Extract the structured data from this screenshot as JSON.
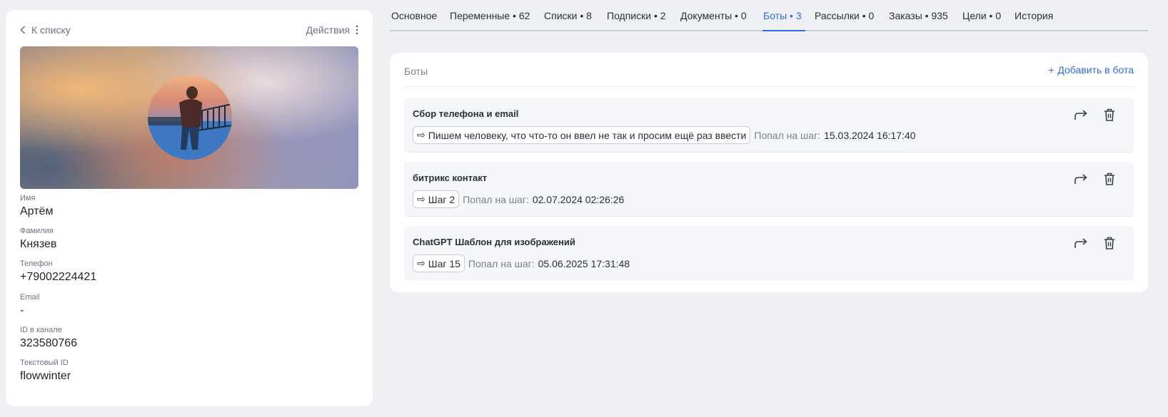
{
  "profile": {
    "back_label": "К списку",
    "actions_label": "Действия",
    "fields": [
      {
        "label": "Имя",
        "value": "Артём"
      },
      {
        "label": "Фамилия",
        "value": "Князев"
      },
      {
        "label": "Телефон",
        "value": "+79002224421"
      },
      {
        "label": "Email",
        "value": "-"
      },
      {
        "label": "ID в канале",
        "value": "323580766"
      },
      {
        "label": "Текстовый ID",
        "value": "flowwinter"
      }
    ]
  },
  "tabs": [
    {
      "label": "Основное",
      "active": false
    },
    {
      "label": "Переменные • 62",
      "active": false
    },
    {
      "label": "Списки • 8",
      "active": false
    },
    {
      "label": "Подписки • 2",
      "active": false
    },
    {
      "label": "Документы • 0",
      "active": false
    },
    {
      "label": "Боты • 3",
      "active": true
    },
    {
      "label": "Рассылки • 0",
      "active": false
    },
    {
      "label": "Заказы • 935",
      "active": false
    },
    {
      "label": "Цели • 0",
      "active": false
    },
    {
      "label": "История",
      "active": false
    }
  ],
  "bots_panel": {
    "title": "Боты",
    "add_label": "Добавить в бота",
    "step_label": "Попал на шаг:",
    "items": [
      {
        "name": "Сбор телефона и email",
        "step": "Пишем человеку, что что-то он ввел не так и просим ещё раз ввести",
        "date": "15.03.2024 16:17:40"
      },
      {
        "name": "битрикс контакт",
        "step": "Шаг 2",
        "date": "02.07.2024 02:26:26"
      },
      {
        "name": "ChatGPT Шаблон для изображений",
        "step": "Шаг 15",
        "date": "05.06.2025 17:31:48"
      }
    ]
  },
  "icons": {
    "step_arrow": "⇨",
    "add": "+"
  },
  "colors": {
    "accent": "#2f6fd6",
    "background": "#eff0f4",
    "card": "#ffffff",
    "bot_item_bg": "#f5f6fa"
  }
}
